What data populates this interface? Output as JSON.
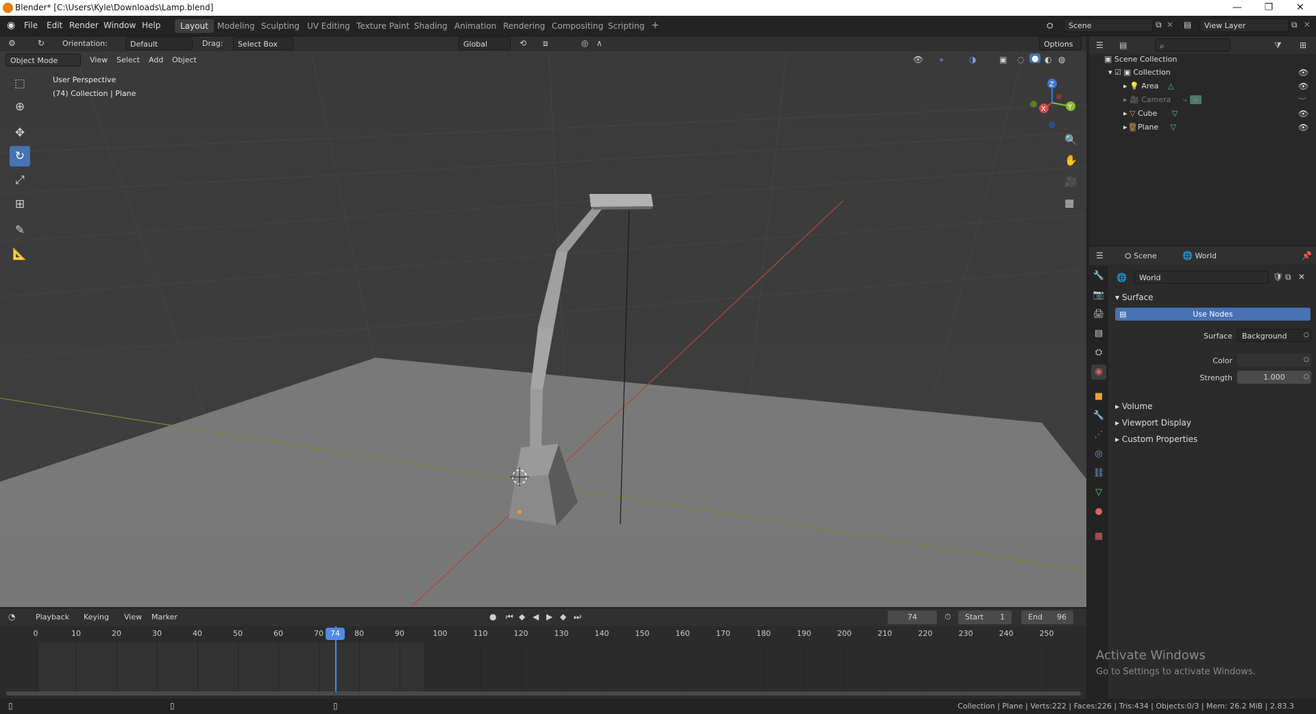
{
  "window": {
    "title": "Blender* [C:\\Users\\Kyle\\Downloads\\Lamp.blend]",
    "min": "—",
    "max": "❐",
    "close": "✕"
  },
  "menus": [
    "File",
    "Edit",
    "Render",
    "Window",
    "Help"
  ],
  "workspaces": [
    "Layout",
    "Modeling",
    "Sculpting",
    "UV Editing",
    "Texture Paint",
    "Shading",
    "Animation",
    "Rendering",
    "Compositing",
    "Scripting"
  ],
  "active_workspace": "Layout",
  "add_workspace": "+",
  "scene": {
    "name": "Scene",
    "view_layer": "View Layer"
  },
  "tool_header": {
    "orientation_label": "Orientation:",
    "orientation_value": "Default",
    "drag_label": "Drag:",
    "drag_value": "Select Box",
    "transform": "Global",
    "options": "Options"
  },
  "viewport_header": {
    "mode": "Object Mode",
    "menus": [
      "View",
      "Select",
      "Add",
      "Object"
    ]
  },
  "viewport_overlay": {
    "perspective": "User Perspective",
    "context": "(74) Collection | Plane"
  },
  "gizmo": {
    "z": "Z",
    "y": "Y",
    "x": "X"
  },
  "outliner": {
    "root": "Scene Collection",
    "collection": "Collection",
    "items": [
      {
        "name": "Area",
        "dim": false
      },
      {
        "name": "Camera",
        "dim": true
      },
      {
        "name": "Cube",
        "dim": false
      },
      {
        "name": "Plane",
        "dim": false
      }
    ]
  },
  "properties": {
    "tabs": [
      "Scene",
      "World"
    ],
    "world_name": "World",
    "surface_section": "Surface",
    "use_nodes": "Use Nodes",
    "surface_label": "Surface",
    "surface_value": "Background",
    "color_label": "Color",
    "strength_label": "Strength",
    "strength_value": "1.000",
    "sections": [
      "Volume",
      "Viewport Display",
      "Custom Properties"
    ]
  },
  "timeline": {
    "menus": [
      "Playback",
      "Keying",
      "View",
      "Marker"
    ],
    "current_frame": "74",
    "start_label": "Start",
    "start": "1",
    "end_label": "End",
    "end": "96",
    "ticks": [
      "0",
      "10",
      "20",
      "30",
      "40",
      "50",
      "60",
      "70",
      "80",
      "90",
      "100",
      "110",
      "120",
      "130",
      "140",
      "150",
      "160",
      "170",
      "180",
      "190",
      "200",
      "210",
      "220",
      "230",
      "240",
      "250"
    ],
    "playhead": "74"
  },
  "activate_windows": {
    "title": "Activate Windows",
    "subtitle": "Go to Settings to activate Windows."
  },
  "statusbar": "Collection | Plane | Verts:222 | Faces:226 | Tris:434 | Objects:0/3 | Mem: 26.2 MiB | 2.83.3",
  "colors": {
    "accent": "#4772b3",
    "viewport_bg": "#3d3d3d",
    "x_axis": "#d94a4a",
    "y_axis": "#8cba2e",
    "z_axis": "#3b78d6"
  }
}
